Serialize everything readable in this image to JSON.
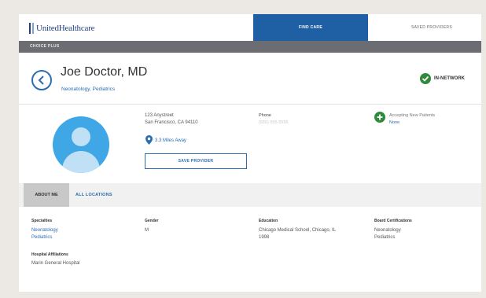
{
  "brand": {
    "name": "UnitedHealthcare"
  },
  "nav": {
    "find_care": "FIND CARE",
    "saved_providers": "SAVED PROVIDERS"
  },
  "subheader": {
    "label": "CHOICE PLUS"
  },
  "doctor": {
    "name": "Joe Doctor, MD",
    "specialties_line": "Neonatology, Pediatrics",
    "network_status": "IN-NETWORK"
  },
  "contact": {
    "address_line1": "123 Anystreet",
    "address_line2": "San Francisco, CA 94110",
    "distance": "3.3 Miles Away",
    "save_button": "SAVE PROVIDER",
    "phone_label": "Phone",
    "phone_value": "(555) 555-5555",
    "accepting_label": "Accepting New Patients",
    "accepting_value": "None"
  },
  "tabs": {
    "about": "ABOUT ME",
    "locations": "ALL LOCATIONS"
  },
  "details": {
    "specialties_label": "Specialties",
    "specialties": [
      "Neonatology",
      "Pediatrics"
    ],
    "gender_label": "Gender",
    "gender": "M",
    "education_label": "Education",
    "education_line1": "Chicago Medical School, Chicago, IL",
    "education_line2": "1998",
    "board_label": "Board Certifications",
    "board": [
      "Neonatology",
      "Pediatrics"
    ],
    "hospital_label": "Hospital Affiliations",
    "hospital": "Marin General Hospital"
  },
  "colors": {
    "brand_blue": "#1f5fa3",
    "link_blue": "#2b6db5",
    "network_green": "#2f8a3b",
    "avatar_blue": "#3fa7e6"
  },
  "icons": {
    "back": "chevron-left-icon",
    "network": "checkmark-circle-icon",
    "location": "map-pin-icon",
    "accepting": "plus-circle-icon"
  }
}
